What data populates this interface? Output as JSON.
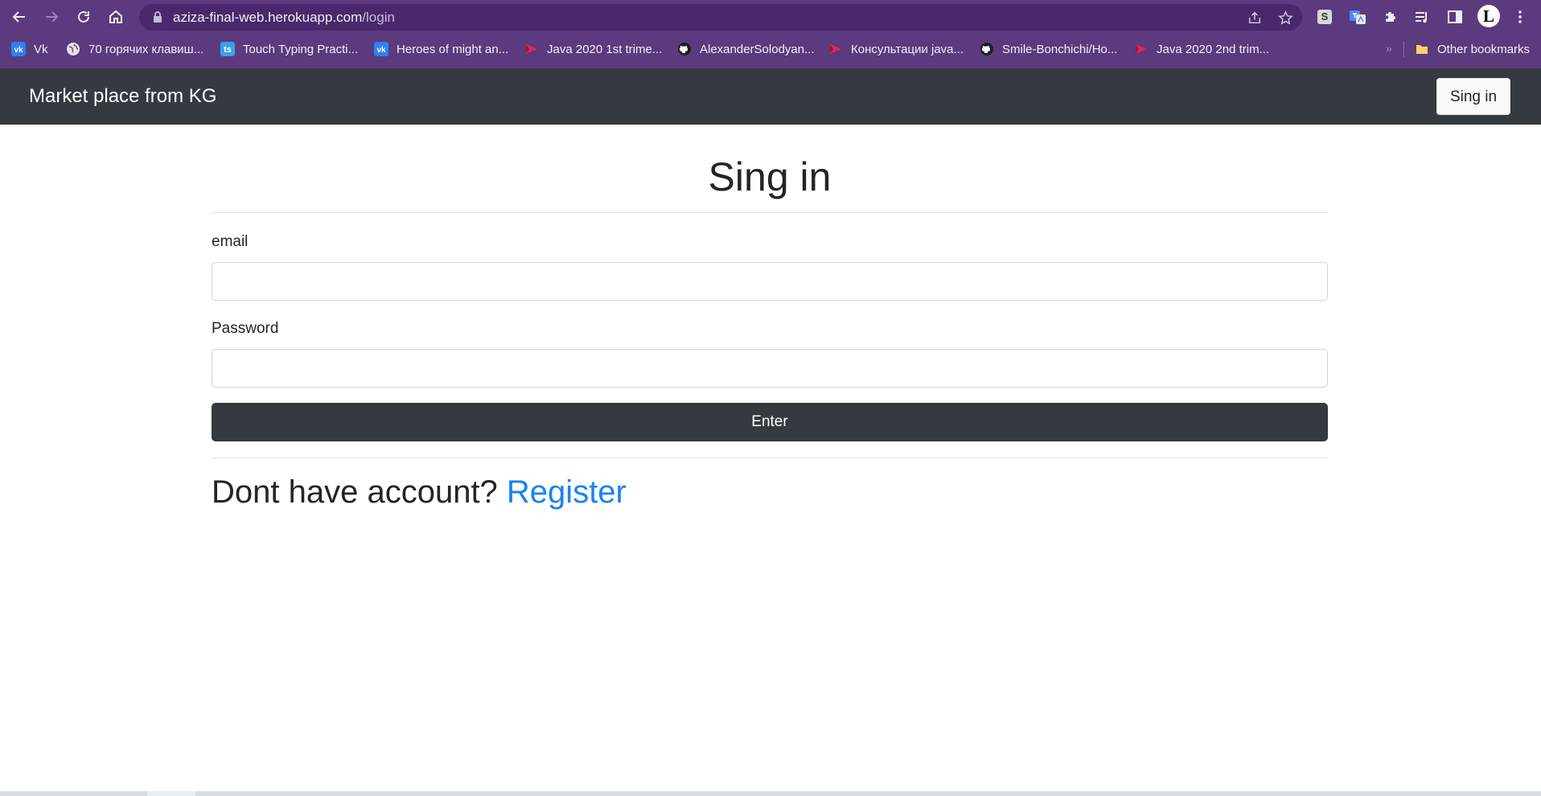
{
  "browser": {
    "url_host": "aziza-final-web.herokuapp.com",
    "url_path": "/login",
    "bookmarks": [
      {
        "label": "Vk",
        "icon": "vk-icon"
      },
      {
        "label": "70 горячих клавиш...",
        "icon": "globe-icon"
      },
      {
        "label": "Touch Typing Practi...",
        "icon": "ts-icon"
      },
      {
        "label": "Heroes of might an...",
        "icon": "vk-icon"
      },
      {
        "label": "Java 2020 1st trime...",
        "icon": "play-icon"
      },
      {
        "label": "AlexanderSolodyan...",
        "icon": "github-icon"
      },
      {
        "label": "Консультации java...",
        "icon": "play-icon"
      },
      {
        "label": "Smile-Bonchichi/Ho...",
        "icon": "github-icon"
      },
      {
        "label": "Java 2020 2nd trim...",
        "icon": "play-icon"
      }
    ],
    "other_bookmarks": "Other bookmarks",
    "overflow_label": "»",
    "ts_text": "ts",
    "vk_text": "vk",
    "ext_s_text": "S",
    "avatar_text": "L"
  },
  "navbar": {
    "brand": "Market place from KG",
    "signin_label": "Sing in"
  },
  "form": {
    "title": "Sing in",
    "email_label": "email",
    "email_value": "",
    "password_label": "Password",
    "password_value": "",
    "submit_label": "Enter"
  },
  "register": {
    "prompt": "Dont have account? ",
    "link": "Register"
  },
  "colors": {
    "chrome": "#5b3a7e",
    "navbar": "#343a40",
    "link": "#1a82f2"
  }
}
